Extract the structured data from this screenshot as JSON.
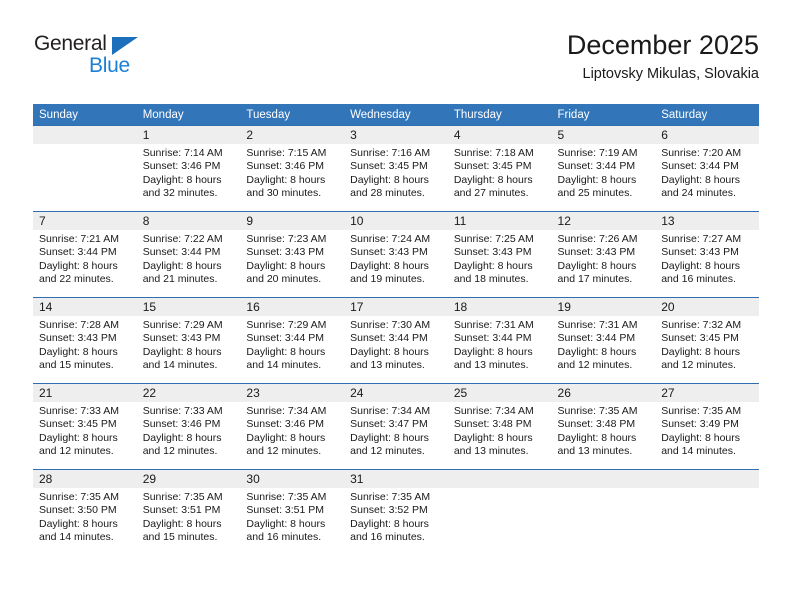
{
  "brand": {
    "name_top": "General",
    "name_bottom": "Blue",
    "triangle_color": "#1c6fba",
    "blue_color": "#1c7fd6"
  },
  "header": {
    "title": "December 2025",
    "subtitle": "Liptovsky Mikulas, Slovakia"
  },
  "theme": {
    "header_bg": "#3275b9",
    "row_line": "#2f6eb0",
    "daynum_bg": "#eeeeee",
    "text": "#1a1a1a"
  },
  "weekday_headers": [
    "Sunday",
    "Monday",
    "Tuesday",
    "Wednesday",
    "Thursday",
    "Friday",
    "Saturday"
  ],
  "weeks": [
    [
      {
        "day": "",
        "sunrise": "",
        "sunset": "",
        "daylight1": "",
        "daylight2": ""
      },
      {
        "day": "1",
        "sunrise": "Sunrise: 7:14 AM",
        "sunset": "Sunset: 3:46 PM",
        "daylight1": "Daylight: 8 hours",
        "daylight2": "and 32 minutes."
      },
      {
        "day": "2",
        "sunrise": "Sunrise: 7:15 AM",
        "sunset": "Sunset: 3:46 PM",
        "daylight1": "Daylight: 8 hours",
        "daylight2": "and 30 minutes."
      },
      {
        "day": "3",
        "sunrise": "Sunrise: 7:16 AM",
        "sunset": "Sunset: 3:45 PM",
        "daylight1": "Daylight: 8 hours",
        "daylight2": "and 28 minutes."
      },
      {
        "day": "4",
        "sunrise": "Sunrise: 7:18 AM",
        "sunset": "Sunset: 3:45 PM",
        "daylight1": "Daylight: 8 hours",
        "daylight2": "and 27 minutes."
      },
      {
        "day": "5",
        "sunrise": "Sunrise: 7:19 AM",
        "sunset": "Sunset: 3:44 PM",
        "daylight1": "Daylight: 8 hours",
        "daylight2": "and 25 minutes."
      },
      {
        "day": "6",
        "sunrise": "Sunrise: 7:20 AM",
        "sunset": "Sunset: 3:44 PM",
        "daylight1": "Daylight: 8 hours",
        "daylight2": "and 24 minutes."
      }
    ],
    [
      {
        "day": "7",
        "sunrise": "Sunrise: 7:21 AM",
        "sunset": "Sunset: 3:44 PM",
        "daylight1": "Daylight: 8 hours",
        "daylight2": "and 22 minutes."
      },
      {
        "day": "8",
        "sunrise": "Sunrise: 7:22 AM",
        "sunset": "Sunset: 3:44 PM",
        "daylight1": "Daylight: 8 hours",
        "daylight2": "and 21 minutes."
      },
      {
        "day": "9",
        "sunrise": "Sunrise: 7:23 AM",
        "sunset": "Sunset: 3:43 PM",
        "daylight1": "Daylight: 8 hours",
        "daylight2": "and 20 minutes."
      },
      {
        "day": "10",
        "sunrise": "Sunrise: 7:24 AM",
        "sunset": "Sunset: 3:43 PM",
        "daylight1": "Daylight: 8 hours",
        "daylight2": "and 19 minutes."
      },
      {
        "day": "11",
        "sunrise": "Sunrise: 7:25 AM",
        "sunset": "Sunset: 3:43 PM",
        "daylight1": "Daylight: 8 hours",
        "daylight2": "and 18 minutes."
      },
      {
        "day": "12",
        "sunrise": "Sunrise: 7:26 AM",
        "sunset": "Sunset: 3:43 PM",
        "daylight1": "Daylight: 8 hours",
        "daylight2": "and 17 minutes."
      },
      {
        "day": "13",
        "sunrise": "Sunrise: 7:27 AM",
        "sunset": "Sunset: 3:43 PM",
        "daylight1": "Daylight: 8 hours",
        "daylight2": "and 16 minutes."
      }
    ],
    [
      {
        "day": "14",
        "sunrise": "Sunrise: 7:28 AM",
        "sunset": "Sunset: 3:43 PM",
        "daylight1": "Daylight: 8 hours",
        "daylight2": "and 15 minutes."
      },
      {
        "day": "15",
        "sunrise": "Sunrise: 7:29 AM",
        "sunset": "Sunset: 3:43 PM",
        "daylight1": "Daylight: 8 hours",
        "daylight2": "and 14 minutes."
      },
      {
        "day": "16",
        "sunrise": "Sunrise: 7:29 AM",
        "sunset": "Sunset: 3:44 PM",
        "daylight1": "Daylight: 8 hours",
        "daylight2": "and 14 minutes."
      },
      {
        "day": "17",
        "sunrise": "Sunrise: 7:30 AM",
        "sunset": "Sunset: 3:44 PM",
        "daylight1": "Daylight: 8 hours",
        "daylight2": "and 13 minutes."
      },
      {
        "day": "18",
        "sunrise": "Sunrise: 7:31 AM",
        "sunset": "Sunset: 3:44 PM",
        "daylight1": "Daylight: 8 hours",
        "daylight2": "and 13 minutes."
      },
      {
        "day": "19",
        "sunrise": "Sunrise: 7:31 AM",
        "sunset": "Sunset: 3:44 PM",
        "daylight1": "Daylight: 8 hours",
        "daylight2": "and 12 minutes."
      },
      {
        "day": "20",
        "sunrise": "Sunrise: 7:32 AM",
        "sunset": "Sunset: 3:45 PM",
        "daylight1": "Daylight: 8 hours",
        "daylight2": "and 12 minutes."
      }
    ],
    [
      {
        "day": "21",
        "sunrise": "Sunrise: 7:33 AM",
        "sunset": "Sunset: 3:45 PM",
        "daylight1": "Daylight: 8 hours",
        "daylight2": "and 12 minutes."
      },
      {
        "day": "22",
        "sunrise": "Sunrise: 7:33 AM",
        "sunset": "Sunset: 3:46 PM",
        "daylight1": "Daylight: 8 hours",
        "daylight2": "and 12 minutes."
      },
      {
        "day": "23",
        "sunrise": "Sunrise: 7:34 AM",
        "sunset": "Sunset: 3:46 PM",
        "daylight1": "Daylight: 8 hours",
        "daylight2": "and 12 minutes."
      },
      {
        "day": "24",
        "sunrise": "Sunrise: 7:34 AM",
        "sunset": "Sunset: 3:47 PM",
        "daylight1": "Daylight: 8 hours",
        "daylight2": "and 12 minutes."
      },
      {
        "day": "25",
        "sunrise": "Sunrise: 7:34 AM",
        "sunset": "Sunset: 3:48 PM",
        "daylight1": "Daylight: 8 hours",
        "daylight2": "and 13 minutes."
      },
      {
        "day": "26",
        "sunrise": "Sunrise: 7:35 AM",
        "sunset": "Sunset: 3:48 PM",
        "daylight1": "Daylight: 8 hours",
        "daylight2": "and 13 minutes."
      },
      {
        "day": "27",
        "sunrise": "Sunrise: 7:35 AM",
        "sunset": "Sunset: 3:49 PM",
        "daylight1": "Daylight: 8 hours",
        "daylight2": "and 14 minutes."
      }
    ],
    [
      {
        "day": "28",
        "sunrise": "Sunrise: 7:35 AM",
        "sunset": "Sunset: 3:50 PM",
        "daylight1": "Daylight: 8 hours",
        "daylight2": "and 14 minutes."
      },
      {
        "day": "29",
        "sunrise": "Sunrise: 7:35 AM",
        "sunset": "Sunset: 3:51 PM",
        "daylight1": "Daylight: 8 hours",
        "daylight2": "and 15 minutes."
      },
      {
        "day": "30",
        "sunrise": "Sunrise: 7:35 AM",
        "sunset": "Sunset: 3:51 PM",
        "daylight1": "Daylight: 8 hours",
        "daylight2": "and 16 minutes."
      },
      {
        "day": "31",
        "sunrise": "Sunrise: 7:35 AM",
        "sunset": "Sunset: 3:52 PM",
        "daylight1": "Daylight: 8 hours",
        "daylight2": "and 16 minutes."
      },
      {
        "day": "",
        "sunrise": "",
        "sunset": "",
        "daylight1": "",
        "daylight2": ""
      },
      {
        "day": "",
        "sunrise": "",
        "sunset": "",
        "daylight1": "",
        "daylight2": ""
      },
      {
        "day": "",
        "sunrise": "",
        "sunset": "",
        "daylight1": "",
        "daylight2": ""
      }
    ]
  ]
}
